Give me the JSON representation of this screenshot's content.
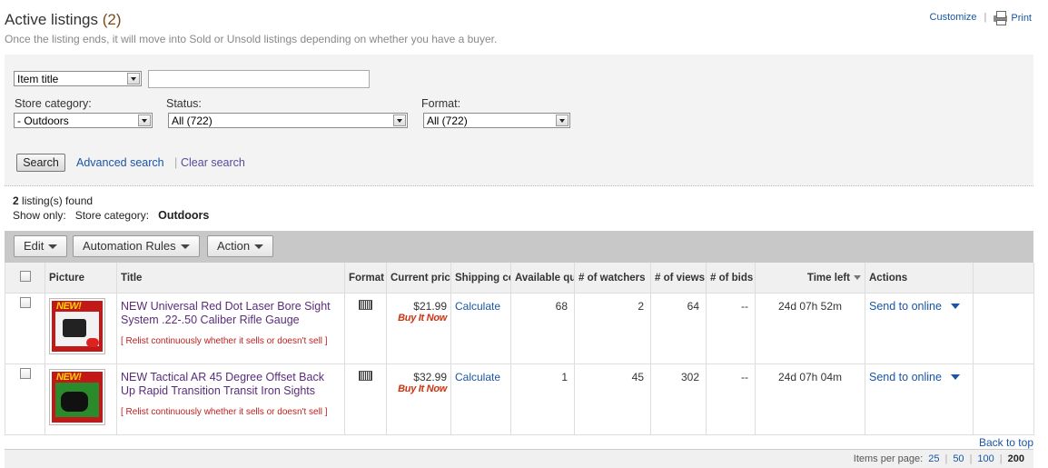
{
  "header": {
    "title": "Active listings",
    "count_open": "(",
    "count": "2",
    "count_close": ")",
    "subtitle": "Once the listing ends, it will move into Sold or Unsold listings depending on whether you have a buyer.",
    "customize_label": "Customize",
    "separator": "|",
    "print_label": "Print"
  },
  "search": {
    "field_select": "Item title",
    "keyword_value": "",
    "store_category_label": "Store category:",
    "store_category_value": "- Outdoors",
    "status_label": "Status:",
    "status_value": "All (722)",
    "format_label": "Format:",
    "format_value": "All (722)",
    "search_button": "Search",
    "advanced_link": "Advanced search",
    "separator": "|",
    "clear_link": "Clear search"
  },
  "results": {
    "found_count": "2",
    "found_text": " listing(s) found",
    "show_only_label": "Show only:",
    "filter_label": "Store category:",
    "filter_value": "Outdoors"
  },
  "toolbar": {
    "edit": "Edit",
    "automation": "Automation Rules",
    "action": "Action"
  },
  "table": {
    "headers": {
      "picture": "Picture",
      "title": "Title",
      "format": "Format",
      "current_price": "Current price",
      "shipping": "Shipping cost",
      "available": "Available quantity",
      "watchers": "# of watchers",
      "views": "# of views",
      "bids": "# of bids",
      "time_left": "Time left",
      "actions": "Actions"
    },
    "rows": [
      {
        "title": "NEW Universal Red Dot Laser Bore Sight System .22-.50 Caliber Rifle Gauge",
        "relist": "[ Relist continuously whether it sells or doesn't sell ]",
        "price": "$21.99",
        "buy_it_now": "Buy It Now",
        "shipping": "Calculate",
        "available": "68",
        "watchers": "2",
        "views": "64",
        "bids": "--",
        "time_left": "24d 07h 52m",
        "action": "Send to online",
        "image_style": "red"
      },
      {
        "title": "NEW Tactical AR 45 Degree Offset Back Up Rapid Transition Transit Iron Sights",
        "relist": "[ Relist continuously whether it sells or doesn't sell ]",
        "price": "$32.99",
        "buy_it_now": "Buy It Now",
        "shipping": "Calculate",
        "available": "1",
        "watchers": "45",
        "views": "302",
        "bids": "--",
        "time_left": "24d 07h 04m",
        "action": "Send to online",
        "image_style": "green"
      }
    ]
  },
  "footer": {
    "back_to_top": "Back to top",
    "items_per_page_label": "Items per page:",
    "options": [
      "25",
      "50",
      "100"
    ],
    "selected": "200"
  },
  "colors": {
    "link": "#1a55a6",
    "visited_title": "#5a2d7a",
    "relist_red": "#bb2222",
    "toolbar_bg": "#c8c8c8"
  }
}
